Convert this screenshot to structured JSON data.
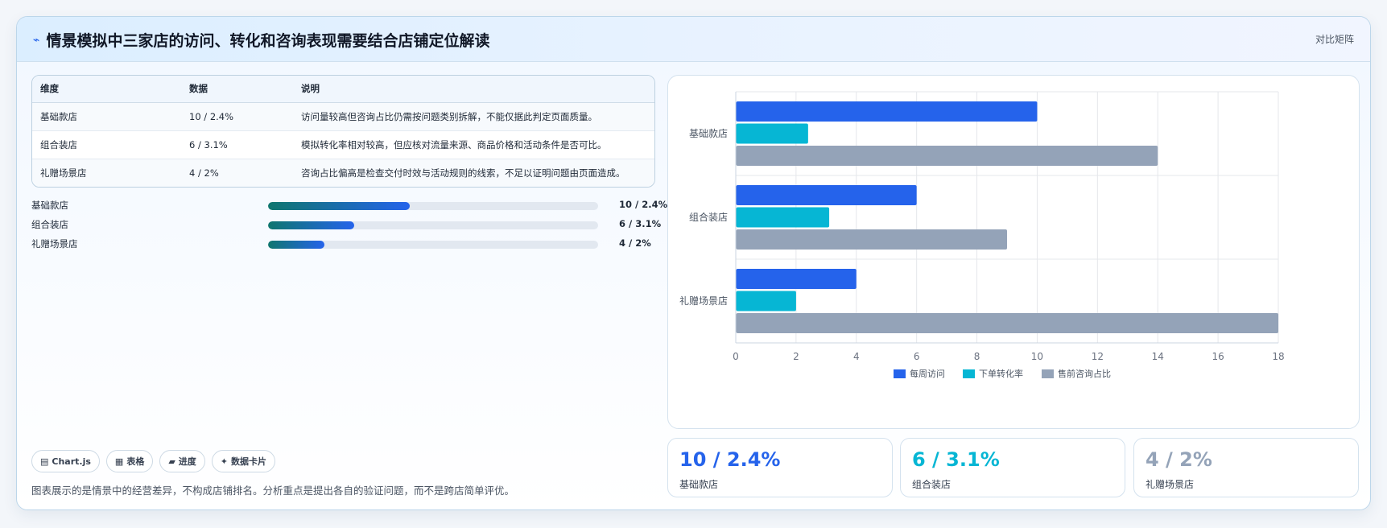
{
  "header": {
    "title": "情景模拟中三家店的访问、转化和咨询表现需要结合店铺定位解读",
    "matrix_label": "对比矩阵"
  },
  "table": {
    "headers": [
      "维度",
      "数据",
      "说明"
    ],
    "rows": [
      [
        "基础款店",
        "10 / 2.4%",
        "访问量较高但咨询占比仍需按问题类别拆解，不能仅据此判定页面质量。"
      ],
      [
        "组合装店",
        "6 / 3.1%",
        "模拟转化率相对较高，但应核对流量来源、商品价格和活动条件是否可比。"
      ],
      [
        "礼赠场景店",
        "4 / 2%",
        "咨询占比偏高是检查交付时效与活动规则的线索，不足以证明问题由页面造成。"
      ]
    ]
  },
  "progress": [
    {
      "label": "基础款店",
      "value": "10 / 2.4%",
      "fraction": 0.43
    },
    {
      "label": "组合装店",
      "value": "6 / 3.1%",
      "fraction": 0.26
    },
    {
      "label": "礼赠场景店",
      "value": "4 / 2%",
      "fraction": 0.17
    }
  ],
  "tags": [
    {
      "icon": "chart-icon",
      "label": "Chart.js"
    },
    {
      "icon": "table-icon",
      "label": "表格"
    },
    {
      "icon": "progress-icon",
      "label": "进度"
    },
    {
      "icon": "sparkle-icon",
      "label": "数据卡片"
    }
  ],
  "footnote": "图表展示的是情景中的经营差异，不构成店铺排名。分析重点是提出各自的验证问题，而不是跨店简单评优。",
  "stats": [
    {
      "value": "10 / 2.4%",
      "label": "基础款店",
      "color": "#2563eb"
    },
    {
      "value": "6 / 3.1%",
      "label": "组合装店",
      "color": "#06b6d4"
    },
    {
      "value": "4 / 2%",
      "label": "礼赠场景店",
      "color": "#94a3b8"
    }
  ],
  "chart_data": {
    "type": "bar",
    "orientation": "horizontal",
    "categories": [
      "基础款店",
      "组合装店",
      "礼赠场景店"
    ],
    "series": [
      {
        "name": "每周访问",
        "values": [
          10,
          6,
          4
        ],
        "color": "#2563eb"
      },
      {
        "name": "下单转化率",
        "values": [
          2.4,
          3.1,
          2
        ],
        "color": "#06b6d4"
      },
      {
        "name": "售前咨询占比",
        "values": [
          14,
          9,
          18
        ],
        "color": "#94a3b8"
      }
    ],
    "xlim": [
      0,
      18
    ],
    "xticks": [
      0,
      2,
      4,
      6,
      8,
      10,
      12,
      14,
      16,
      18
    ],
    "grid": true,
    "legend": "bottom"
  }
}
